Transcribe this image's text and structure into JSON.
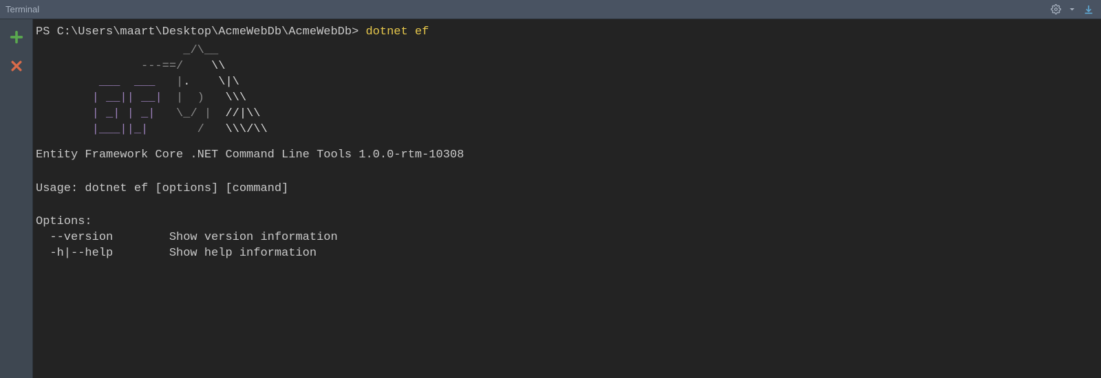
{
  "titlebar": {
    "title": "Terminal"
  },
  "sidebar": {
    "addLabel": "add",
    "closeLabel": "close"
  },
  "terminal": {
    "promptPrefix": "PS C:\\Users\\maart\\Desktop\\AcmeWebDb\\AcmeWebDb> ",
    "promptCommand": "dotnet ef",
    "asciiArt": {
      "lines": [
        {
          "indent": "                     ",
          "grey": "_/\\__       ",
          "white": ""
        },
        {
          "indent": "               ",
          "grey": "---==/",
          "white": "    \\\\      "
        },
        {
          "indent": "         ",
          "purple": "___  ___ ",
          "grey": "  |",
          "white": ".    \\|\\    "
        },
        {
          "indent": "        ",
          "purple": "| __|| __|",
          "grey": "  |  )  ",
          "white": " \\\\\\   "
        },
        {
          "indent": "        ",
          "purple": "| _| | _| ",
          "grey": "  \\_/ |",
          "white": "  //|\\\\ "
        },
        {
          "indent": "        ",
          "purple": "|___||_|  ",
          "grey": "     /",
          "white": "   \\\\\\/\\\\"
        }
      ]
    },
    "toolLine": "Entity Framework Core .NET Command Line Tools 1.0.0-rtm-10308",
    "usageLine": "Usage: dotnet ef [options] [command]",
    "optionsHeader": "Options:",
    "options": [
      {
        "flag": "  --version        ",
        "desc": "Show version information"
      },
      {
        "flag": "  -h|--help        ",
        "desc": "Show help information"
      }
    ]
  }
}
